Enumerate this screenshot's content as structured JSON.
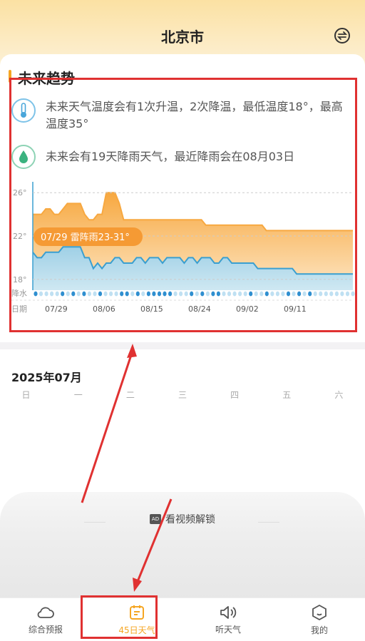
{
  "header": {
    "city": "北京市"
  },
  "trend": {
    "title": "未来趋势",
    "temp_summary": "未来天气温度会有1次升温，2次降温，最低温度18°，最高温度35°",
    "rain_summary": "未来会有19天降雨天气，最近降雨会在08月03日"
  },
  "chart_data": {
    "type": "area",
    "y_tick_labels": [
      "26°",
      "22°",
      "18°"
    ],
    "row_labels": {
      "rain": "降水",
      "date": "日期"
    },
    "x_tick_labels": [
      "07/29",
      "08/06",
      "08/15",
      "08/24",
      "09/02",
      "09/11"
    ],
    "tooltip": "07/29 雷阵雨23-31°",
    "colors": {
      "high": "#f7a840",
      "low": "#3a9fd0",
      "tooltip": "#f59a34"
    },
    "series": [
      {
        "values": [
          24,
          24,
          24,
          24.5,
          24.5,
          24,
          24,
          24.5,
          25,
          25,
          25,
          25,
          24,
          23.5,
          23.5,
          24,
          24,
          26,
          26,
          26,
          25,
          23.5,
          23.5,
          23.5,
          23.5,
          23.5,
          23.5,
          23.5,
          23.5,
          23.5,
          23.5,
          23.5,
          23.5,
          23.5,
          23.5,
          23.5,
          23.5,
          23.5,
          23.5,
          23.5,
          23,
          23,
          23,
          23,
          23,
          23,
          23,
          23,
          23,
          23,
          23,
          23,
          23,
          23,
          22.5,
          22.5,
          22.5,
          22.5,
          22.5,
          22.5,
          22.5,
          22.5,
          22.5,
          22.5,
          22.5,
          22.5,
          22.5,
          22.5,
          22.5,
          22.5,
          22.5,
          22.5,
          22.5,
          22.5,
          22.5
        ]
      },
      {
        "values": [
          20.5,
          20,
          20,
          20.5,
          20.5,
          20.5,
          20.5,
          21,
          21,
          21,
          21,
          21,
          20,
          20,
          19,
          19.5,
          19,
          19.5,
          19.5,
          20,
          20,
          19.5,
          19.5,
          19.5,
          20,
          20,
          19.5,
          20,
          20,
          20,
          19.5,
          20,
          20,
          20,
          20,
          19.5,
          20,
          20,
          19.5,
          20,
          20,
          20,
          19.5,
          19.5,
          20,
          20,
          19.5,
          19.5,
          19.5,
          19.5,
          19.5,
          19.5,
          19,
          19,
          19,
          19,
          19,
          19,
          19,
          19,
          19,
          18.5,
          18.5,
          18.5,
          18.5,
          18.5,
          18.5,
          18.5,
          18.5,
          18.5,
          18.5,
          18.5,
          18.5,
          18.5,
          18.5
        ]
      }
    ],
    "ylim": [
      17,
      27
    ],
    "rain_days": [
      1,
      0,
      0,
      0,
      0,
      1,
      0,
      1,
      0,
      1,
      0,
      0,
      1,
      0,
      0,
      0,
      1,
      1,
      0,
      1,
      0,
      1,
      1,
      1,
      1,
      1,
      0,
      0,
      0,
      1,
      0,
      1,
      0,
      1,
      1,
      0,
      0,
      0,
      0,
      0,
      1,
      0,
      0,
      1,
      0,
      0,
      0,
      1,
      0,
      1,
      0,
      1,
      0,
      0,
      0,
      0,
      0,
      0,
      0,
      0
    ]
  },
  "calendar": {
    "month_title": "2025年07月",
    "weekdays": [
      "日",
      "一",
      "二",
      "三",
      "四",
      "五",
      "六"
    ]
  },
  "unlock": {
    "ad_label": "AD",
    "text": "看视频解锁"
  },
  "nav": {
    "items": [
      {
        "label": "综合预报",
        "icon": "cloud-icon"
      },
      {
        "label": "45日天气",
        "icon": "calendar-icon"
      },
      {
        "label": "听天气",
        "icon": "speaker-icon"
      },
      {
        "label": "我的",
        "icon": "profile-icon"
      }
    ],
    "active_color": "#f5a623"
  }
}
